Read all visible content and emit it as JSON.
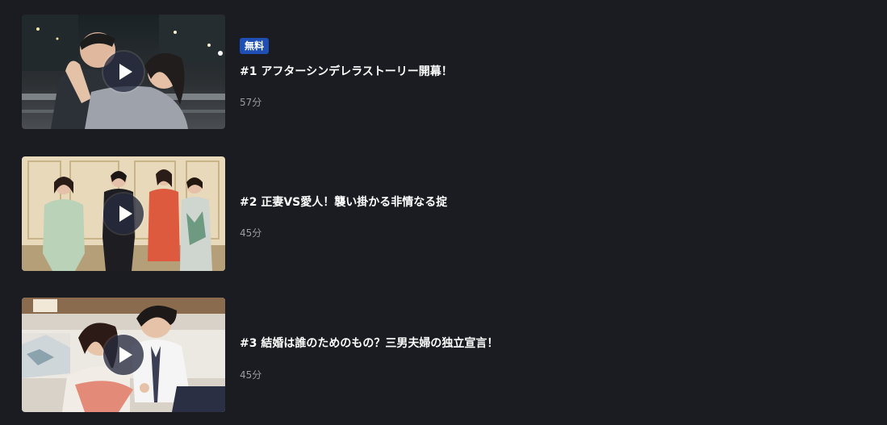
{
  "episodes": [
    {
      "badge": "無料",
      "title": "#1 アフターシンデレラストーリー開幕！",
      "duration": "57分",
      "thumbnail_icon": "play-icon"
    },
    {
      "title": "#2 正妻VS愛人！襲い掛かる非情なる掟",
      "duration": "45分",
      "thumbnail_icon": "play-icon"
    },
    {
      "title": "#3 結婚は誰のためのもの？三男夫婦の独立宣言！",
      "duration": "45分",
      "thumbnail_icon": "play-icon"
    }
  ],
  "colors": {
    "background": "#1b1c21",
    "badge": "#1f4fb5",
    "duration_text": "#9a9ca3"
  }
}
